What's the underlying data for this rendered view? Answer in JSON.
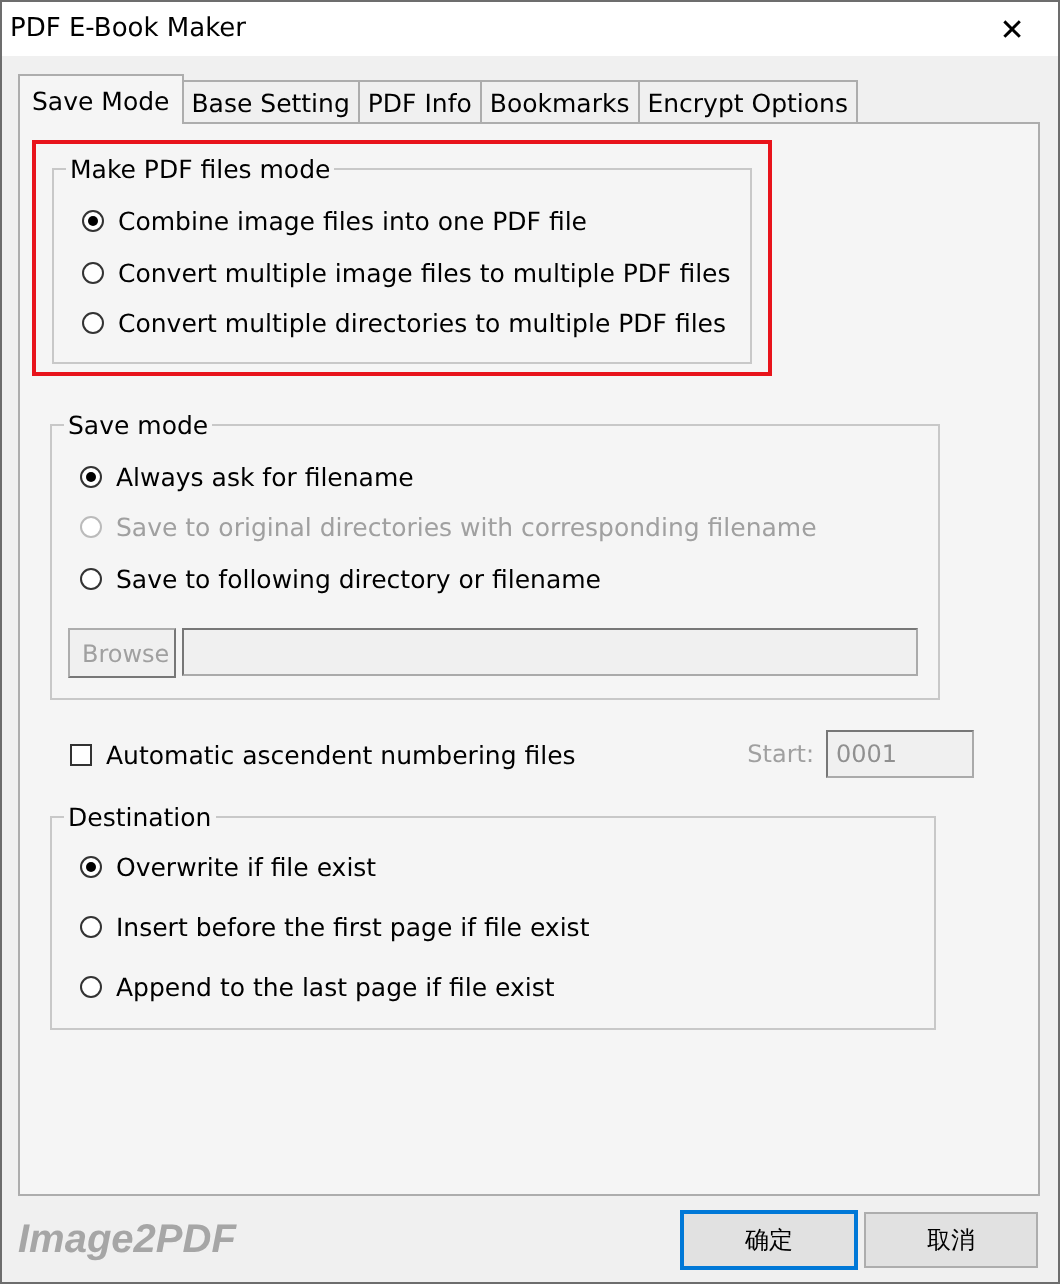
{
  "window": {
    "title": "PDF E-Book Maker",
    "close": "✕"
  },
  "tabs": [
    {
      "label": "Save Mode",
      "selected": true
    },
    {
      "label": "Base Setting",
      "selected": false
    },
    {
      "label": "PDF Info",
      "selected": false
    },
    {
      "label": "Bookmarks",
      "selected": false
    },
    {
      "label": "Encrypt Options",
      "selected": false
    }
  ],
  "make_mode": {
    "title": "Make PDF files mode",
    "highlighted": true,
    "options": [
      {
        "label": "Combine image files into one PDF file",
        "selected": true,
        "disabled": false
      },
      {
        "label": "Convert multiple image files to multiple PDF files",
        "selected": false,
        "disabled": false
      },
      {
        "label": "Convert multiple directories to multiple PDF files",
        "selected": false,
        "disabled": false
      }
    ]
  },
  "save_mode": {
    "title": "Save mode",
    "options": [
      {
        "label": "Always ask for filename",
        "selected": true,
        "disabled": false
      },
      {
        "label": "Save to original directories with corresponding filename",
        "selected": false,
        "disabled": true
      },
      {
        "label": "Save to following directory or filename",
        "selected": false,
        "disabled": false
      }
    ],
    "browse": {
      "label": "Browse",
      "disabled": true
    },
    "path": {
      "disabled": true
    }
  },
  "numbering": {
    "label": "Automatic ascendent numbering files",
    "checked": false,
    "start_label": "Start:",
    "start_value": "0001",
    "start_disabled": true
  },
  "destination": {
    "title": "Destination",
    "options": [
      {
        "label": "Overwrite if file exist",
        "selected": true,
        "disabled": false
      },
      {
        "label": "Insert before the first page if file exist",
        "selected": false,
        "disabled": false
      },
      {
        "label": "Append to the last page if file exist",
        "selected": false,
        "disabled": false
      }
    ]
  },
  "footer": {
    "brand": "Image2PDF",
    "buttons": [
      "确定",
      "取消"
    ]
  }
}
